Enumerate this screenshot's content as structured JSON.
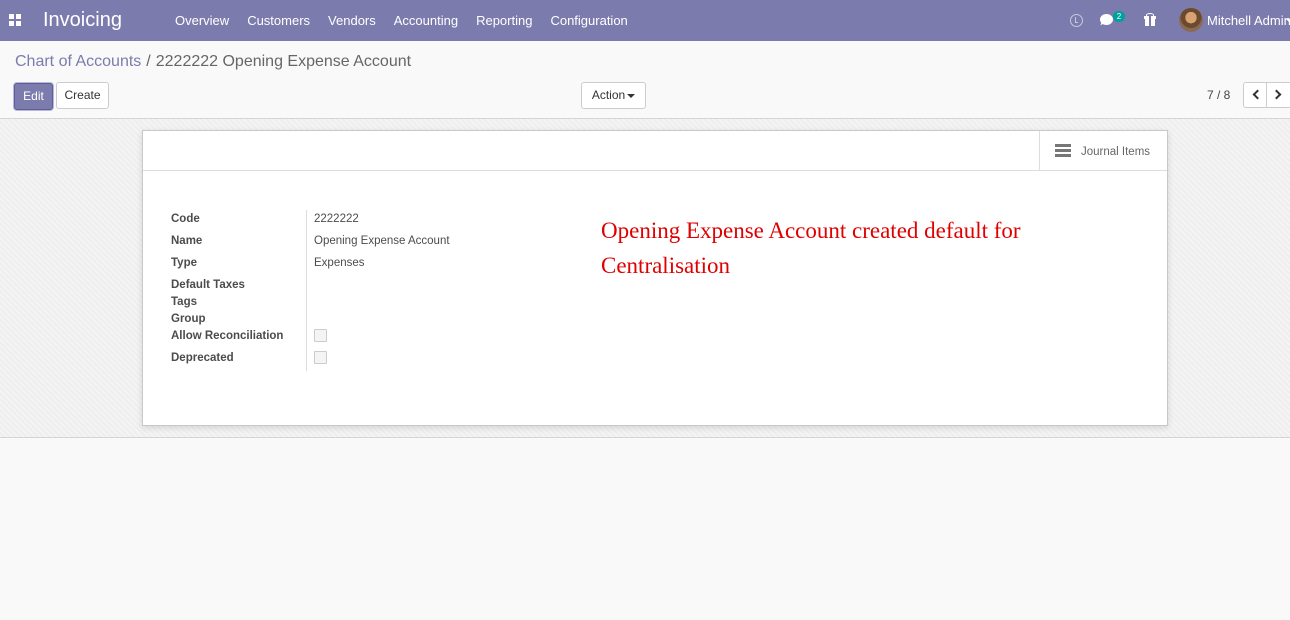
{
  "navbar": {
    "app_name": "Invoicing",
    "menu": [
      "Overview",
      "Customers",
      "Vendors",
      "Accounting",
      "Reporting",
      "Configuration"
    ],
    "chat_badge": "2",
    "user_name": "Mitchell Admin",
    "bg_color": "#7c7bad"
  },
  "breadcrumb": {
    "parent": "Chart of Accounts",
    "separator": "/",
    "current": "2222222 Opening Expense Account"
  },
  "toolbar": {
    "edit_label": "Edit",
    "create_label": "Create",
    "action_label": "Action"
  },
  "pager": {
    "value": "7 / 8"
  },
  "smart_button": {
    "label": "Journal Items"
  },
  "form": {
    "labels": {
      "code": "Code",
      "name": "Name",
      "type": "Type",
      "default_taxes": "Default Taxes",
      "tags": "Tags",
      "group": "Group",
      "allow_reconciliation": "Allow Reconciliation",
      "deprecated": "Deprecated"
    },
    "values": {
      "code": "2222222",
      "name": "Opening Expense Account",
      "type": "Expenses",
      "allow_reconciliation": false,
      "deprecated": false
    }
  },
  "annotation": {
    "text": "Opening Expense Account created default for Centralisation",
    "color": "#e00000"
  }
}
